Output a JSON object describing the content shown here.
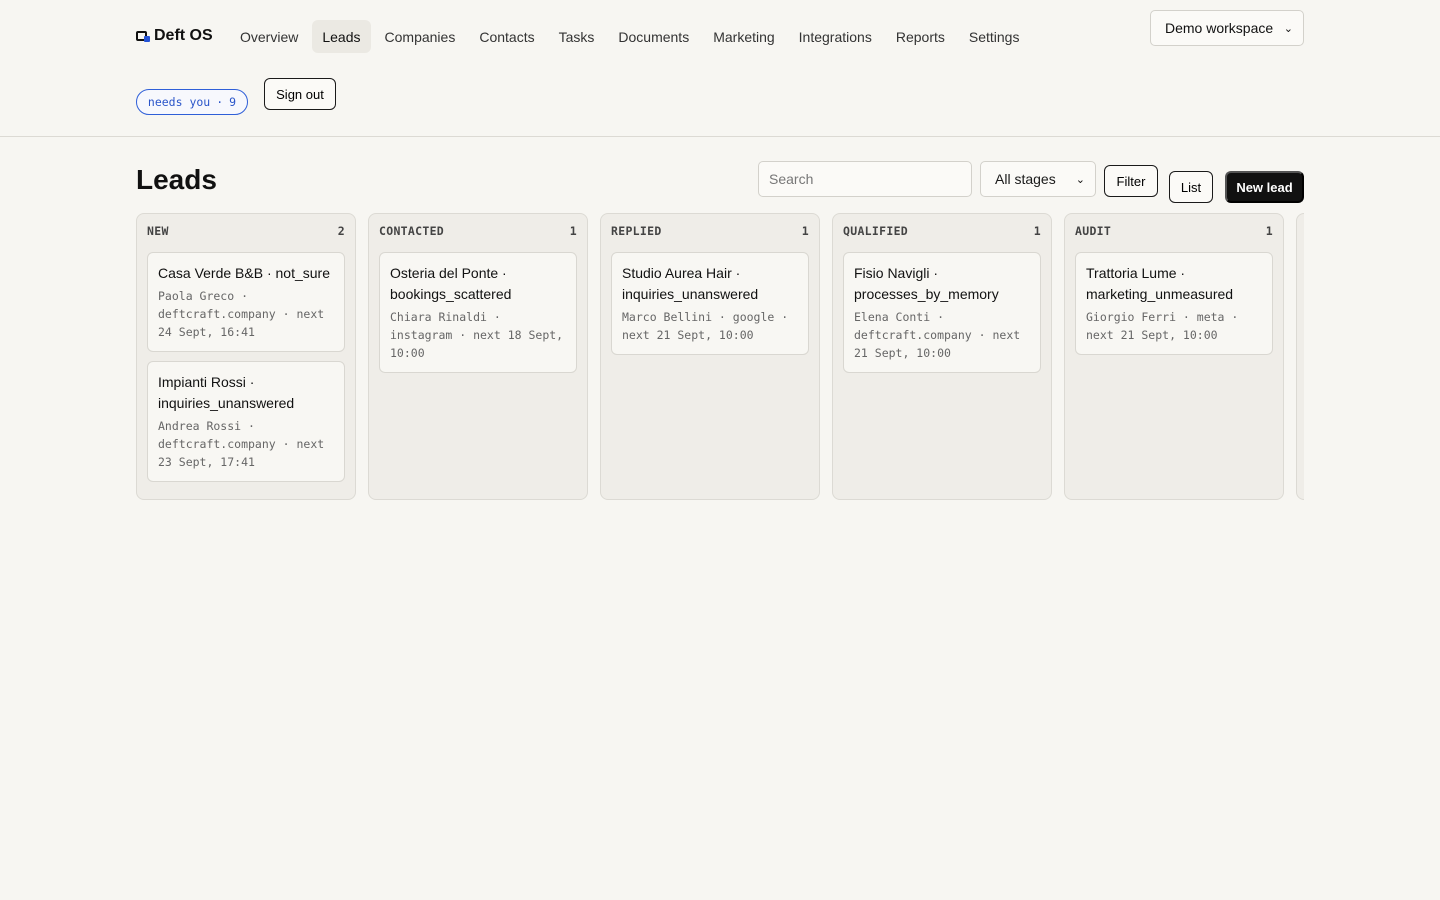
{
  "brand": {
    "name": "Deft OS"
  },
  "nav": [
    {
      "label": "Overview"
    },
    {
      "label": "Leads",
      "active": true
    },
    {
      "label": "Companies"
    },
    {
      "label": "Contacts"
    },
    {
      "label": "Tasks"
    },
    {
      "label": "Documents"
    },
    {
      "label": "Marketing"
    },
    {
      "label": "Integrations"
    },
    {
      "label": "Reports"
    },
    {
      "label": "Settings"
    }
  ],
  "workspace": {
    "selected": "Demo workspace"
  },
  "needs_badge": {
    "label": "needs you",
    "sep": "·",
    "count": "9"
  },
  "sign_out": "Sign out",
  "page": {
    "title": "Leads"
  },
  "toolbar": {
    "search_placeholder": "Search",
    "stage_selected": "All stages",
    "filter": "Filter",
    "list": "List",
    "new_lead": "New lead"
  },
  "columns": [
    {
      "name": "NEW",
      "count": "2",
      "cards": [
        {
          "title": "Casa Verde B&B · not_sure",
          "meta": "Paola Greco · deftcraft.company · next 24 Sept, 16:41"
        },
        {
          "title": "Impianti Rossi · inquiries_unanswered",
          "meta": "Andrea Rossi · deftcraft.company · next 23 Sept, 17:41"
        }
      ]
    },
    {
      "name": "CONTACTED",
      "count": "1",
      "cards": [
        {
          "title": "Osteria del Ponte · bookings_scattered",
          "meta": "Chiara Rinaldi · instagram · next 18 Sept, 10:00"
        }
      ]
    },
    {
      "name": "REPLIED",
      "count": "1",
      "cards": [
        {
          "title": "Studio Aurea Hair · inquiries_unanswered",
          "meta": "Marco Bellini · google · next 21 Sept, 10:00"
        }
      ]
    },
    {
      "name": "QUALIFIED",
      "count": "1",
      "cards": [
        {
          "title": "Fisio Navigli · processes_by_memory",
          "meta": "Elena Conti · deftcraft.company · next 21 Sept, 10:00"
        }
      ]
    },
    {
      "name": "AUDIT",
      "count": "1",
      "cards": [
        {
          "title": "Trattoria Lume · marketing_unmeasured",
          "meta": "Giorgio Ferri · meta · next 21 Sept, 10:00"
        }
      ]
    }
  ]
}
